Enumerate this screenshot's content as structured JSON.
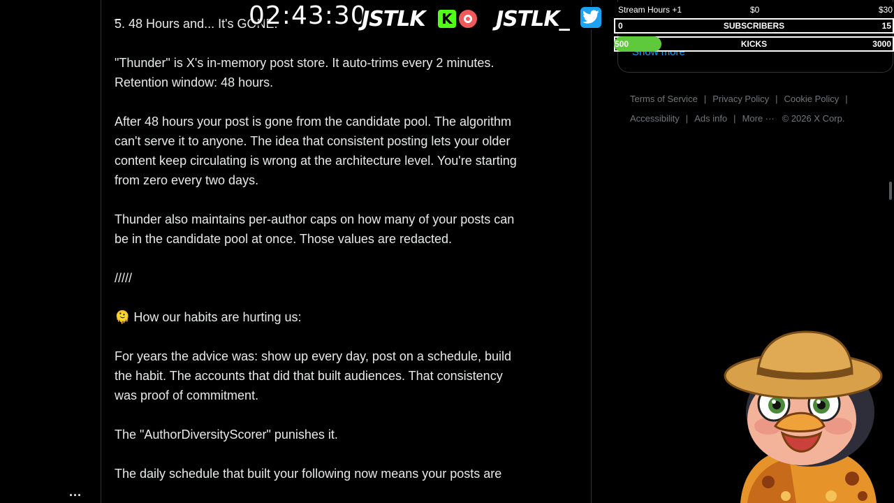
{
  "post": {
    "dash": "_",
    "paragraphs": [
      "5. 48 Hours and... It's GONE.",
      "\"Thunder\" is X's in-memory post store. It auto-trims every 2 minutes.\nRetention window: 48 hours.",
      "After 48 hours your post is gone from the candidate pool. The algorithm\ncan't serve it to anyone. The idea that consistent posting lets your older\ncontent keep circulating is wrong at the architecture level. You're starting\nfrom zero every two days.",
      "Thunder also maintains per-author caps on how many of your posts can\nbe in the candidate pool at once. Those values are redacted.",
      "/////",
      "🫠 How our habits are hurting us:",
      "For years the advice was: show up every day, post on a schedule, build\nthe habit. The accounts that did that built audiences. That consistency\nwas proof of commitment.",
      "The \"AuthorDiversityScorer\" punishes it.",
      "The daily schedule that built your following now means your posts are"
    ]
  },
  "sidebar": {
    "more_label": "..."
  },
  "right": {
    "show_more": "Show more",
    "footer": {
      "terms": "Terms of Service",
      "privacy": "Privacy Policy",
      "cookie": "Cookie Policy",
      "accessibility": "Accessibility",
      "ads": "Ads info",
      "more": "More ···",
      "copyright": "© 2026 X Corp."
    }
  },
  "overlay": {
    "timer": "02:43:30",
    "brand1": "JSTLK",
    "brand2": "JSTLK_",
    "kick_letter": "K",
    "stats": {
      "stream_hours": "Stream Hours +1",
      "stream_amount": "$0",
      "stream_goal": "$30",
      "subs_current": "0",
      "subs_label": "SUBSCRIBERS",
      "subs_goal": "15",
      "kicks_current": "500",
      "kicks_label": "KICKS",
      "kicks_goal": "3000",
      "kicks_progress": 0.17
    }
  }
}
